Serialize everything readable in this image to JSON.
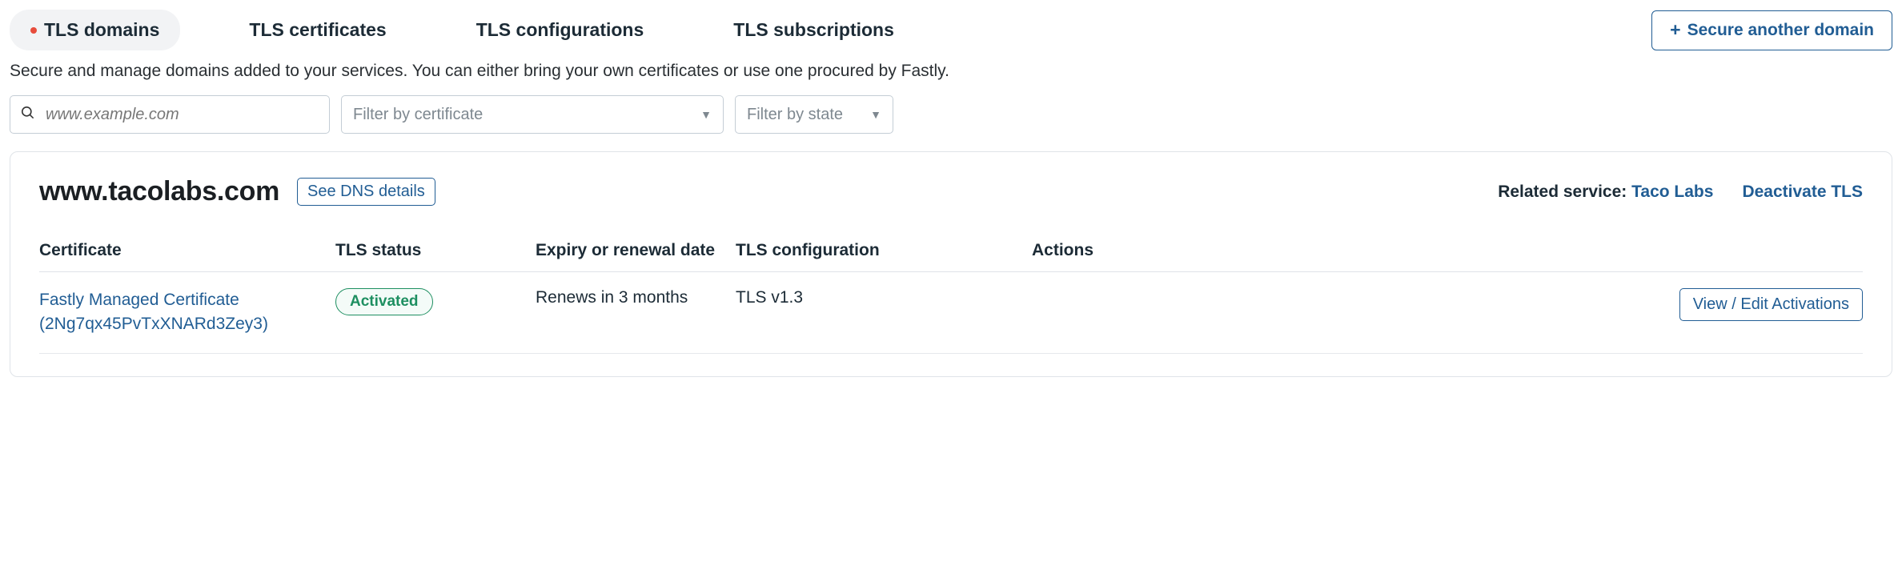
{
  "tabs": {
    "items": [
      {
        "label": "TLS domains",
        "active": true,
        "hasDot": true
      },
      {
        "label": "TLS certificates"
      },
      {
        "label": "TLS configurations"
      },
      {
        "label": "TLS subscriptions"
      }
    ]
  },
  "secure_button": {
    "label": "Secure another domain"
  },
  "description": "Secure and manage domains added to your services. You can either bring your own certificates or use one procured by Fastly.",
  "search": {
    "placeholder": "www.example.com"
  },
  "filter_cert": {
    "placeholder": "Filter by certificate"
  },
  "filter_state": {
    "placeholder": "Filter by state"
  },
  "domain_card": {
    "domain_name": "www.tacolabs.com",
    "dns_button": "See DNS details",
    "related_service_label": "Related service:",
    "related_service_value": "Taco Labs",
    "deactivate_label": "Deactivate TLS"
  },
  "table": {
    "headers": {
      "certificate": "Certificate",
      "tls_status": "TLS status",
      "expiry": "Expiry or renewal date",
      "tls_config": "TLS configuration",
      "actions": "Actions"
    },
    "row": {
      "certificate_line1": "Fastly Managed Certificate",
      "certificate_line2": "(2Ng7qx45PvTxXNARd3Zey3)",
      "status": "Activated",
      "expiry": "Renews in 3 months",
      "config": "TLS v1.3",
      "action_label": "View / Edit Activations"
    }
  }
}
